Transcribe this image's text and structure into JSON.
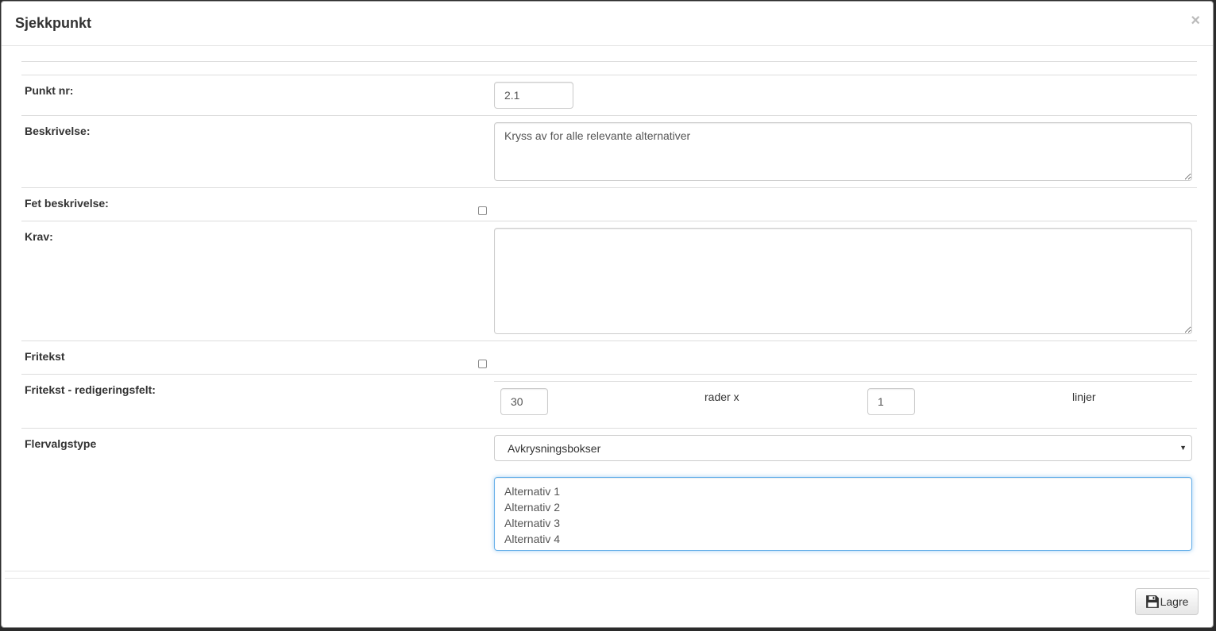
{
  "modal": {
    "title": "Sjekkpunkt",
    "close_label": "×"
  },
  "form": {
    "punkt_nr": {
      "label": "Punkt nr:",
      "value": "2.1"
    },
    "beskrivelse": {
      "label": "Beskrivelse:",
      "value": "Kryss av for alle relevante alternativer"
    },
    "fet_beskrivelse": {
      "label": "Fet beskrivelse:",
      "checked": false
    },
    "krav": {
      "label": "Krav:",
      "value": ""
    },
    "fritekst": {
      "label": "Fritekst",
      "checked": false
    },
    "fritekst_felt": {
      "label": "Fritekst - redigeringsfelt:",
      "rows_value": "30",
      "rows_text": "rader x",
      "lines_value": "1",
      "lines_text": "linjer"
    },
    "flervalgstype": {
      "label": "Flervalgstype",
      "selected": "Avkrysningsbokser",
      "options": [
        "Alternativ 1",
        "Alternativ 2",
        "Alternativ 3",
        "Alternativ 4"
      ]
    }
  },
  "footer": {
    "save_label": "Lagre"
  },
  "icons": {
    "save": "floppy-disk-icon",
    "close": "close-icon",
    "caret": "caret-down-icon"
  },
  "colors": {
    "focus_border": "#66afe9",
    "border": "#cccccc"
  }
}
